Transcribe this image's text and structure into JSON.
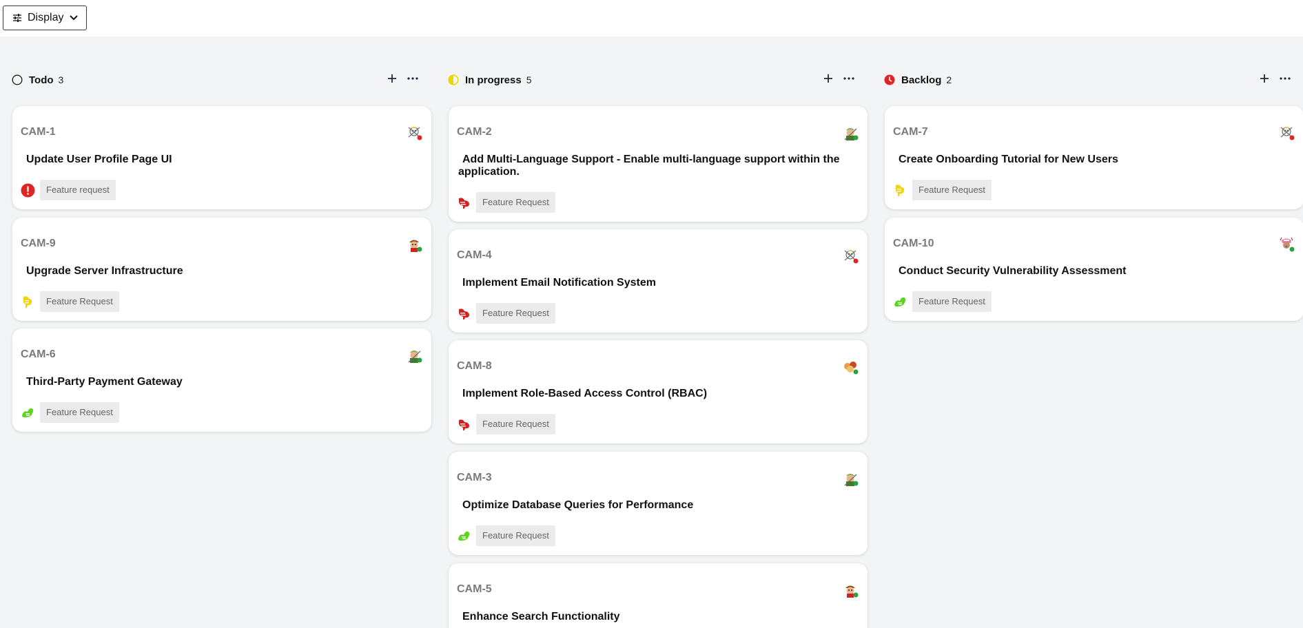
{
  "toolbar": {
    "display_label": "Display",
    "display_icon": "sliders-icon",
    "chevron_icon": "chevron-down-icon"
  },
  "columns": [
    {
      "title": "Todo",
      "count": "3",
      "status_icon": "circle-outline-icon",
      "cards": [
        {
          "id": "CAM-1",
          "title": "Update User Profile Page UI",
          "tag": "Feature request",
          "priority_icon": "urgent-icon",
          "avatar": "skull-avatar"
        },
        {
          "id": "CAM-9",
          "title": "Upgrade Server Infrastructure",
          "tag": "Feature Request",
          "priority_icon": "yellow-priority-icon",
          "avatar": "pirate-avatar"
        },
        {
          "id": "CAM-6",
          "title": "Third-Party Payment Gateway",
          "tag": "Feature Request",
          "priority_icon": "green-priority-icon",
          "avatar": "swordsman-avatar"
        }
      ]
    },
    {
      "title": "In progress",
      "count": "5",
      "status_icon": "half-circle-icon",
      "cards": [
        {
          "id": "CAM-2",
          "title": "Add Multi-Language Support - Enable multi-language support within the application.",
          "tag": "Feature Request",
          "priority_icon": "red-priority-icon",
          "avatar": "swordsman-avatar"
        },
        {
          "id": "CAM-4",
          "title": "Implement Email Notification System",
          "tag": "Feature Request",
          "priority_icon": "red-priority-icon",
          "avatar": "skull-avatar"
        },
        {
          "id": "CAM-8",
          "title": "Implement Role-Based Access Control (RBAC)",
          "tag": "Feature Request",
          "priority_icon": "red-priority-icon",
          "avatar": "crew-avatar"
        },
        {
          "id": "CAM-3",
          "title": "Optimize Database Queries for Performance",
          "tag": "Feature Request",
          "priority_icon": "green-priority-icon",
          "avatar": "swordsman-avatar"
        },
        {
          "id": "CAM-5",
          "title": "Enhance Search Functionality",
          "tag": "",
          "priority_icon": "",
          "avatar": "pirate-avatar"
        }
      ]
    },
    {
      "title": "Backlog",
      "count": "2",
      "status_icon": "clock-icon",
      "cards": [
        {
          "id": "CAM-7",
          "title": "Create Onboarding Tutorial for New Users",
          "tag": "Feature Request",
          "priority_icon": "yellow-priority-icon",
          "avatar": "skull-avatar"
        },
        {
          "id": "CAM-10",
          "title": "Conduct Security Vulnerability Assessment",
          "tag": "Feature Request",
          "priority_icon": "green-priority-icon",
          "avatar": "reindeer-avatar"
        }
      ]
    }
  ],
  "colors": {
    "todo": "#222222",
    "in_progress": "#e8d900",
    "backlog": "#e02424",
    "urgent": "#e02424",
    "red_priority": "#d32020",
    "yellow_priority": "#f1d40e",
    "green_priority": "#5bd51e",
    "online_dot": "#2ea043",
    "busy_dot": "#e02424"
  }
}
